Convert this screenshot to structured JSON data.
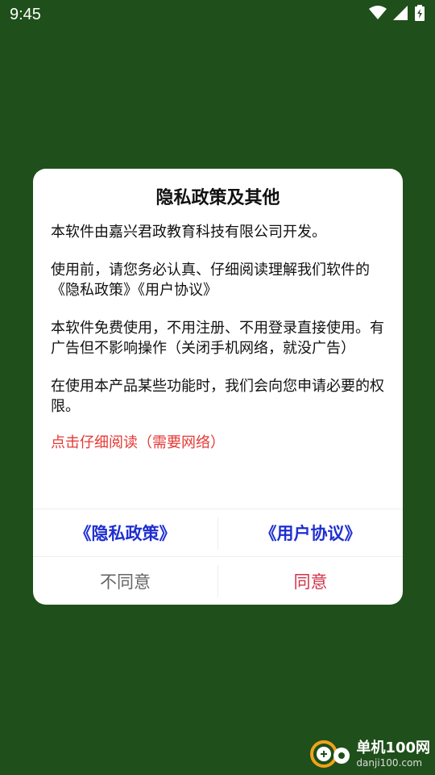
{
  "status_bar": {
    "time": "9:45"
  },
  "dialog": {
    "title": "隐私政策及其他",
    "paragraphs": [
      "本软件由嘉兴君政教育科技有限公司开发。",
      "使用前，请您务必认真、仔细阅读理解我们软件的《隐私政策》《用户协议》",
      "本软件免费使用，不用注册、不用登录直接使用。有广告但不影响操作（关闭手机网络，就没广告）",
      "在使用本产品某些功能时，我们会向您申请必要的权限。"
    ],
    "read_link": "点击仔细阅读（需要网络）",
    "privacy_button": "《隐私政策》",
    "agreement_button": "《用户协议》",
    "disagree_button": "不同意",
    "agree_button": "同意"
  },
  "watermark": {
    "brand": "单机100网",
    "url": "danji100.com"
  },
  "colors": {
    "background": "#1f4f1a",
    "link_blue": "#1f2fd0",
    "warn_red": "#e53935",
    "agree_red": "#d1334a"
  }
}
